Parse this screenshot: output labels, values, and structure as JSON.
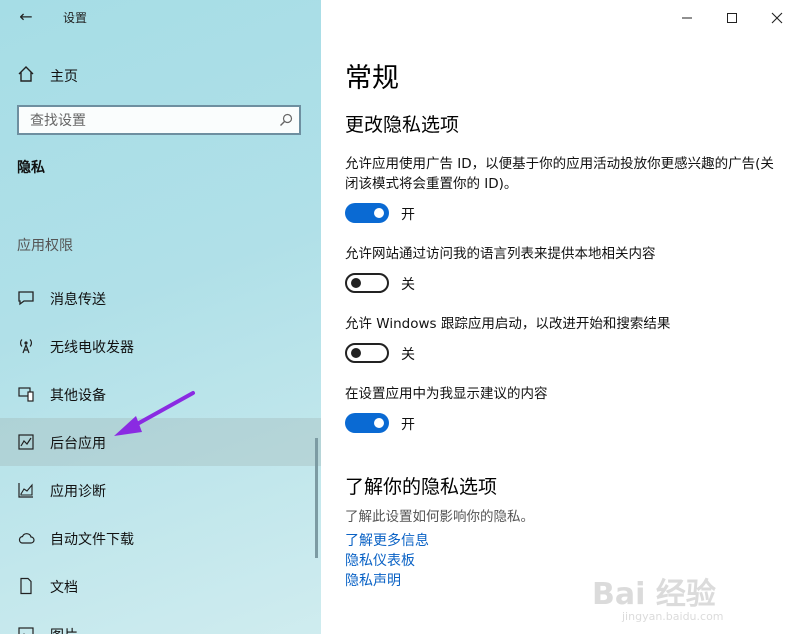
{
  "window": {
    "title": "设置"
  },
  "sidebar": {
    "home_label": "主页",
    "search_placeholder": "查找设置",
    "section_title": "隐私",
    "group_label": "应用权限",
    "items": [
      {
        "label": "消息传送",
        "icon": "chat-icon"
      },
      {
        "label": "无线电收发器",
        "icon": "antenna-icon"
      },
      {
        "label": "其他设备",
        "icon": "devices-icon"
      },
      {
        "label": "后台应用",
        "icon": "background-apps-icon",
        "active": true
      },
      {
        "label": "应用诊断",
        "icon": "diagnostics-icon"
      },
      {
        "label": "自动文件下载",
        "icon": "cloud-icon"
      },
      {
        "label": "文档",
        "icon": "document-icon"
      },
      {
        "label": "图片",
        "icon": "picture-icon"
      }
    ]
  },
  "main": {
    "title": "常规",
    "section1_title": "更改隐私选项",
    "options": [
      {
        "text": "允许应用使用广告 ID，以便基于你的应用活动投放你更感兴趣的广告(关闭该模式将会重置你的 ID)。",
        "state": "开",
        "on": true
      },
      {
        "text": "允许网站通过访问我的语言列表来提供本地相关内容",
        "state": "关",
        "on": false
      },
      {
        "text": "允许 Windows 跟踪应用启动，以改进开始和搜索结果",
        "state": "关",
        "on": false
      },
      {
        "text": "在设置应用中为我显示建议的内容",
        "state": "开",
        "on": true
      }
    ],
    "section2_title": "了解你的隐私选项",
    "section2_desc": "了解此设置如何影响你的隐私。",
    "links": [
      "了解更多信息",
      "隐私仪表板",
      "隐私声明"
    ]
  },
  "watermark": {
    "text": "Bai 经验",
    "url": "jingyan.baidu.com"
  },
  "colors": {
    "accent": "#0a6ad3",
    "link": "#0a62c5",
    "arrow": "#8a2be2"
  }
}
